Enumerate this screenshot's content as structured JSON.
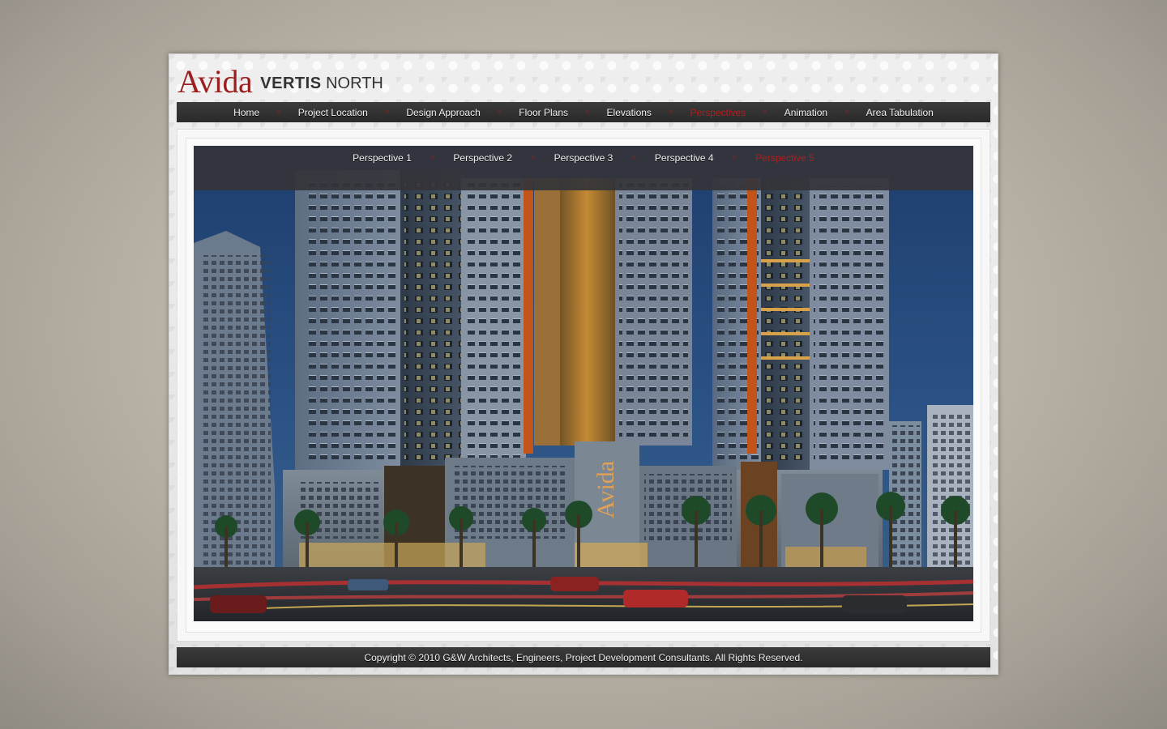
{
  "brand": {
    "logo_main": "Avida",
    "logo_sub_bold": "VERTIS",
    "logo_sub": "NORTH"
  },
  "nav": {
    "items": [
      {
        "label": "Home",
        "active": false
      },
      {
        "label": "Project Location",
        "active": false
      },
      {
        "label": "Design Approach",
        "active": false
      },
      {
        "label": "Floor Plans",
        "active": false
      },
      {
        "label": "Elevations",
        "active": false
      },
      {
        "label": "Perspectives",
        "active": true
      },
      {
        "label": "Animation",
        "active": false
      },
      {
        "label": "Area Tabulation",
        "active": false
      }
    ]
  },
  "subnav": {
    "items": [
      {
        "label": "Perspective 1",
        "active": false
      },
      {
        "label": "Perspective 2",
        "active": false
      },
      {
        "label": "Perspective 3",
        "active": false
      },
      {
        "label": "Perspective 4",
        "active": false
      },
      {
        "label": "Perspective 5",
        "active": true
      }
    ]
  },
  "image": {
    "signage": "Avida"
  },
  "footer": {
    "copyright": "Copyright © 2010 G&W Architects, Engineers, Project Development Consultants. All Rights Reserved."
  },
  "colors": {
    "accent": "#b01e1e",
    "bar": "#2f2f2f",
    "logo": "#9c1f1f"
  },
  "icons": {
    "separator": "x-separator-icon"
  }
}
